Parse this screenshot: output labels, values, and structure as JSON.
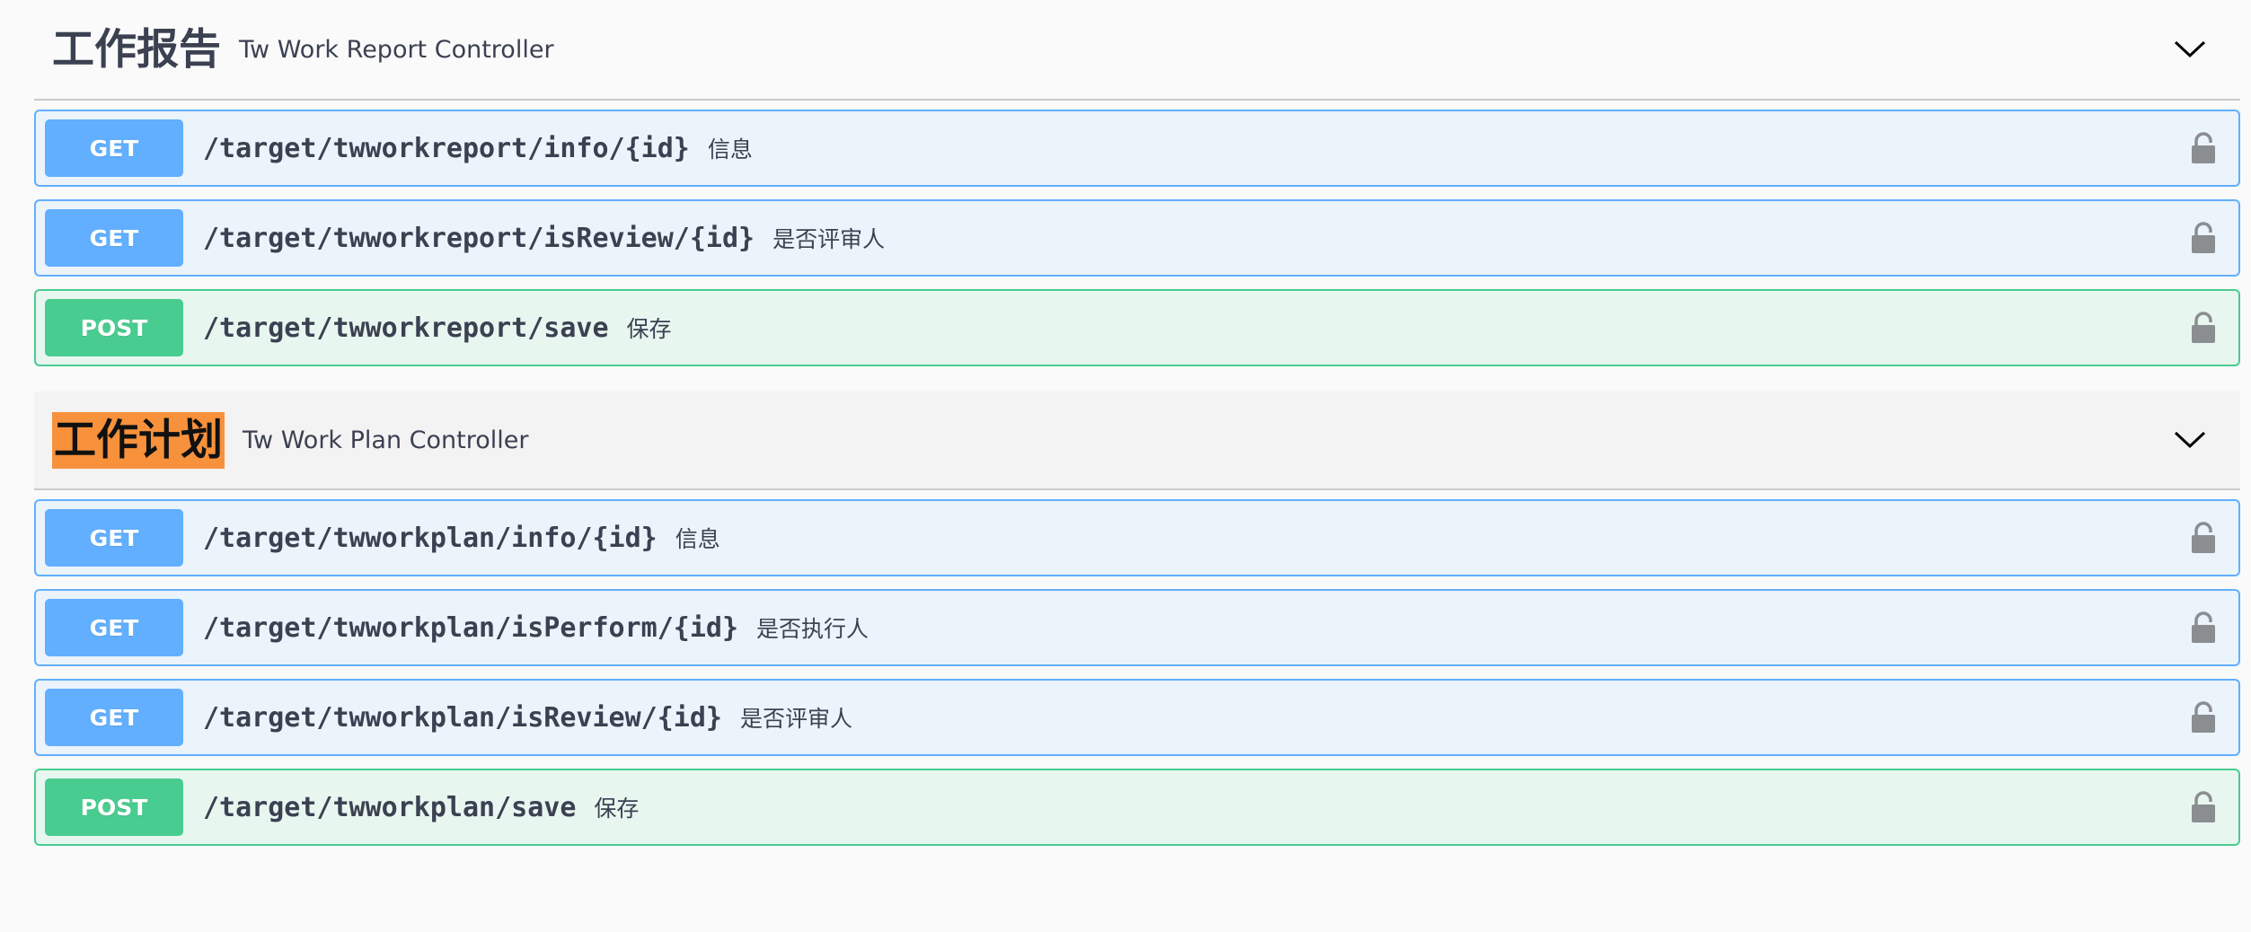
{
  "colors": {
    "get": "#61affe",
    "post": "#49cc90",
    "highlight": "#f7913b"
  },
  "sections": [
    {
      "title": "工作报告",
      "description": "Tw Work Report Controller",
      "toggle_icon": "chevron-down-icon",
      "operations": [
        {
          "method": "GET",
          "path": "/target/twworkreport/info/{id}",
          "summary": "信息",
          "icon": "lock-icon"
        },
        {
          "method": "GET",
          "path": "/target/twworkreport/isReview/{id}",
          "summary": "是否评审人",
          "icon": "lock-icon"
        },
        {
          "method": "POST",
          "path": "/target/twworkreport/save",
          "summary": "保存",
          "icon": "lock-icon"
        }
      ]
    },
    {
      "title": "工作计划",
      "description": "Tw Work Plan Controller",
      "toggle_icon": "chevron-down-icon",
      "operations": [
        {
          "method": "GET",
          "path": "/target/twworkplan/info/{id}",
          "summary": "信息",
          "icon": "lock-icon"
        },
        {
          "method": "GET",
          "path": "/target/twworkplan/isPerform/{id}",
          "summary": "是否执行人",
          "icon": "lock-icon"
        },
        {
          "method": "GET",
          "path": "/target/twworkplan/isReview/{id}",
          "summary": "是否评审人",
          "icon": "lock-icon"
        },
        {
          "method": "POST",
          "path": "/target/twworkplan/save",
          "summary": "保存",
          "icon": "lock-icon"
        }
      ]
    }
  ]
}
